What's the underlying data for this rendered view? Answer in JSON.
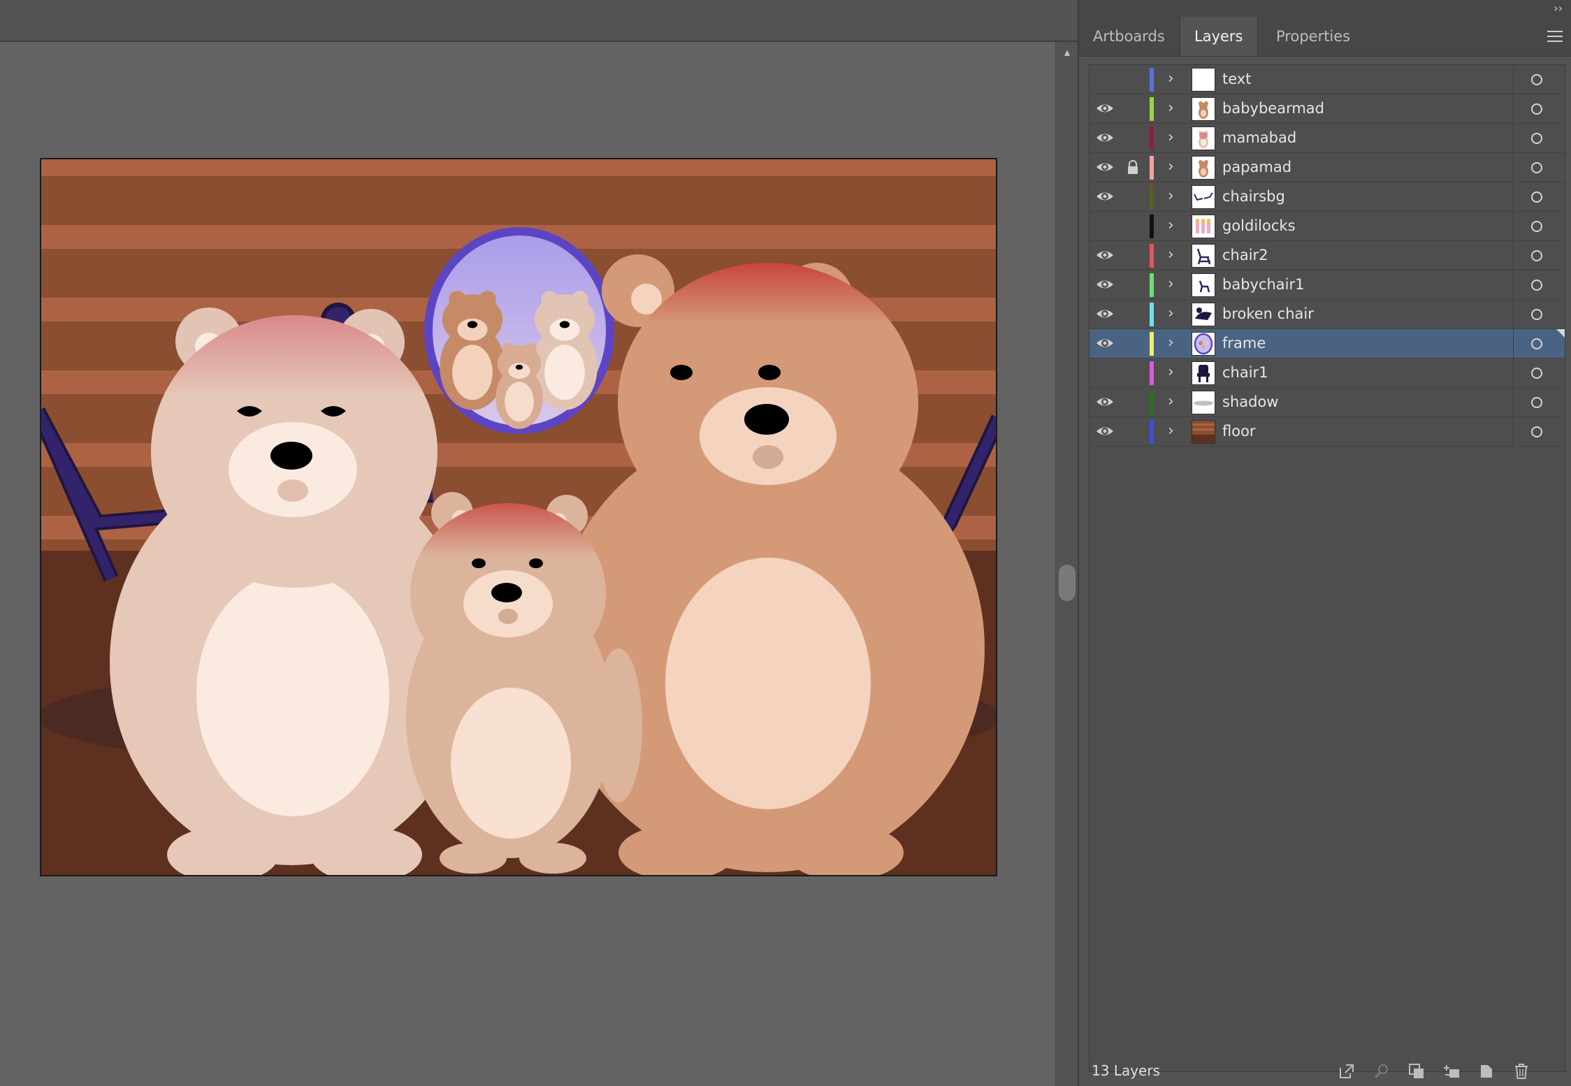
{
  "panel": {
    "tabs": [
      {
        "label": "Artboards",
        "active": false
      },
      {
        "label": "Layers",
        "active": true
      },
      {
        "label": "Properties",
        "active": false
      }
    ],
    "collapse_glyph": "››",
    "layers": [
      {
        "name": "text",
        "visible": false,
        "locked": false,
        "color": "#4f73e8",
        "selected": false,
        "thumb": "blank"
      },
      {
        "name": "babybearmad",
        "visible": true,
        "locked": false,
        "color": "#9cd24a",
        "selected": false,
        "thumb": "bear"
      },
      {
        "name": "mamabad",
        "visible": true,
        "locked": false,
        "color": "#8c1f3c",
        "selected": false,
        "thumb": "bear-light"
      },
      {
        "name": "papamad",
        "visible": true,
        "locked": true,
        "color": "#f2a3a0",
        "selected": false,
        "thumb": "bear"
      },
      {
        "name": "chairsbg",
        "visible": true,
        "locked": false,
        "color": "#5b5e1f",
        "selected": false,
        "thumb": "chairs"
      },
      {
        "name": "goldilocks",
        "visible": false,
        "locked": false,
        "color": "#111111",
        "selected": false,
        "thumb": "goldilocks"
      },
      {
        "name": "chair2",
        "visible": true,
        "locked": false,
        "color": "#e8565a",
        "selected": false,
        "thumb": "chair"
      },
      {
        "name": "babychair1",
        "visible": true,
        "locked": false,
        "color": "#69e075",
        "selected": false,
        "thumb": "chair-small"
      },
      {
        "name": "broken chair",
        "visible": true,
        "locked": false,
        "color": "#62e6ee",
        "selected": false,
        "thumb": "broken"
      },
      {
        "name": "frame",
        "visible": true,
        "locked": false,
        "color": "#f2ee6b",
        "selected": true,
        "thumb": "frame"
      },
      {
        "name": "chair1",
        "visible": false,
        "locked": false,
        "color": "#d95bd8",
        "selected": false,
        "thumb": "chair-dark"
      },
      {
        "name": "shadow",
        "visible": true,
        "locked": false,
        "color": "#2e6e24",
        "selected": false,
        "thumb": "shadow"
      },
      {
        "name": "floor",
        "visible": true,
        "locked": false,
        "color": "#3e4de0",
        "selected": false,
        "thumb": "floor"
      }
    ],
    "footer": {
      "layer_count": "13 Layers"
    }
  },
  "colors": {
    "panel_bg": "#535353",
    "selection": "#4a6382",
    "canvas_bg": "#636363",
    "wall_light": "#ad6343",
    "wall_dark": "#8b4e30",
    "floor": "#5e3020",
    "chair_purple": "#33236b",
    "frame_border": "#5c45c4",
    "papa_bear": "#d49a78",
    "mama_bear": "#e6c8b8",
    "baby_bear": "#dcb49c"
  }
}
